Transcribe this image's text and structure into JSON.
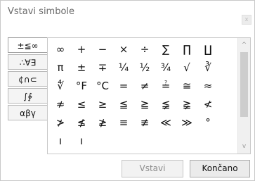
{
  "dialog": {
    "title": "Vstavi simbole",
    "close_glyph": "x"
  },
  "categories": [
    {
      "label": "±≦∞",
      "active": true
    },
    {
      "label": "∴∀∃",
      "active": false
    },
    {
      "label": "¢∩⊂",
      "active": false
    },
    {
      "label": "∫∲",
      "active": false
    },
    {
      "label": "αβγ",
      "active": false
    }
  ],
  "symbols": [
    "∞",
    "+",
    "−",
    "×",
    "÷",
    "∑",
    "∏",
    "",
    "∐",
    "π",
    "±",
    "∓",
    "¼",
    "½",
    "¾",
    "",
    "√",
    "∛",
    "∜",
    "°F",
    "°C",
    "=",
    "≠",
    "",
    "≟",
    "≅",
    "≈",
    "≉",
    "≤",
    "≥",
    "≦",
    "",
    "≧",
    "≨",
    "≩",
    "≮",
    "≯",
    "≰",
    "≱",
    "",
    "≡",
    "≢",
    "≪",
    "≫",
    "°",
    "ı",
    "ı",
    "",
    "",
    "",
    "",
    "",
    "",
    "",
    "",
    ""
  ],
  "scrollbar": {
    "up_glyph": "^",
    "down_glyph": "v"
  },
  "buttons": {
    "insert": "Vstavi",
    "done": "Končano"
  }
}
